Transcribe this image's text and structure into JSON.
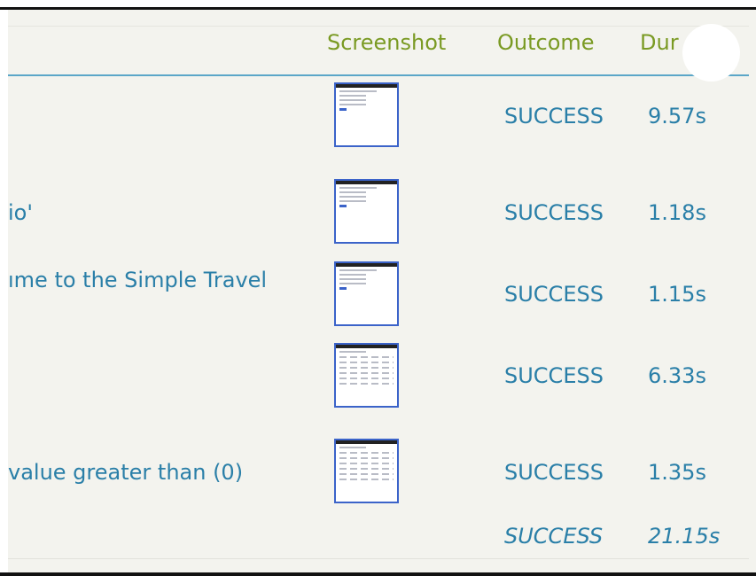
{
  "table": {
    "columns": {
      "screenshot": "Screenshot",
      "outcome": "Outcome",
      "duration": "Dur"
    },
    "rows": [
      {
        "text": "",
        "outcome": "SUCCESS",
        "duration": "9.57s",
        "thumb": "page"
      },
      {
        "text": "io'",
        "outcome": "SUCCESS",
        "duration": "1.18s",
        "thumb": "page"
      },
      {
        "text": "ıme to the Simple Travel",
        "outcome": "SUCCESS",
        "duration": "1.15s",
        "thumb": "page"
      },
      {
        "text": "",
        "outcome": "SUCCESS",
        "duration": "6.33s",
        "thumb": "table"
      },
      {
        "text": "value greater than (0)",
        "outcome": "SUCCESS",
        "duration": "1.35s",
        "thumb": "table"
      }
    ],
    "total": {
      "outcome": "SUCCESS",
      "duration": "21.15s"
    }
  },
  "colors": {
    "header": "#7a9a23",
    "link": "#2a7fa8",
    "thumb_border": "#3b63c9"
  }
}
